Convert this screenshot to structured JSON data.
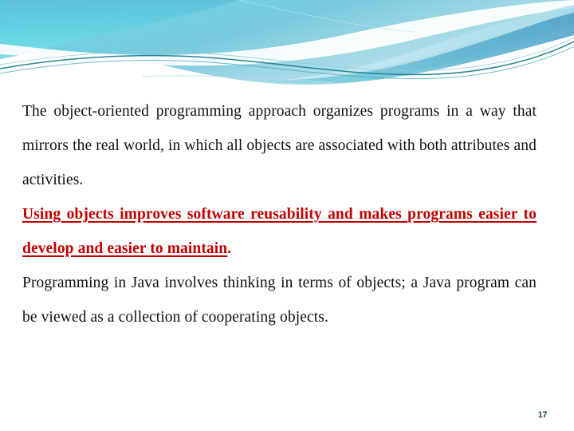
{
  "slide": {
    "page_number": "17",
    "background_color": "#ffffff",
    "accent_colors": {
      "wave_cyan_light": "#7FE3EE",
      "wave_cyan": "#5BC8DE",
      "wave_blue": "#6FB7D4",
      "wave_teal_line": "#1F7F8C",
      "wave_pale": "#BFE7F0",
      "highlight_red": "#C00000",
      "page_number_color": "#1F4E5A",
      "body_text_color": "#101010"
    }
  },
  "body": {
    "paragraph_1": "The object-oriented programming approach organizes programs in a way that mirrors the real world, in which all objects are associated with both attributes and activities.",
    "highlight_words": [
      "Using",
      "objects",
      "improves",
      "software",
      "reusability",
      "and",
      "makes",
      "programs",
      "easier",
      "to",
      "develop",
      "and",
      "easier",
      "to",
      "maintain"
    ],
    "highlight_trailing_punctuation": ".",
    "paragraph_3": "Programming in Java involves thinking in terms of objects; a Java program can be viewed as a collection of cooperating objects."
  }
}
